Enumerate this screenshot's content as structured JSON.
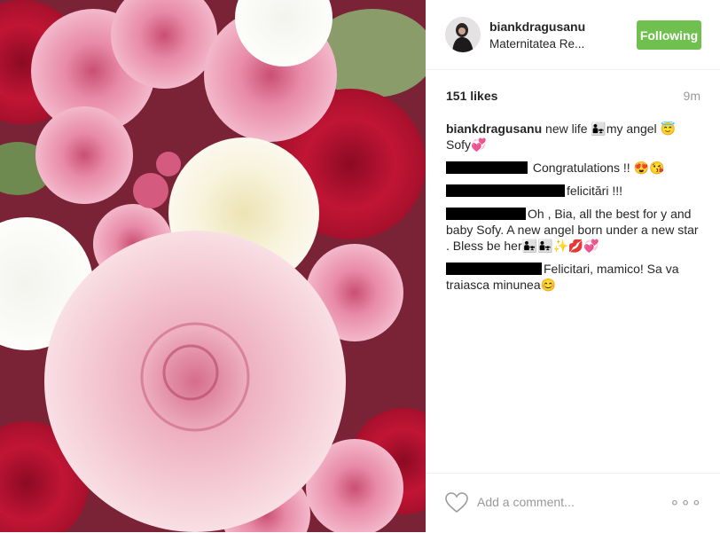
{
  "post": {
    "username": "biankdragusanu",
    "location": "Maternitatea Re...",
    "follow_label": "Following",
    "likes": "151 likes",
    "time": "9m",
    "comment_placeholder": "Add a comment...",
    "more_label": "∘∘∘"
  },
  "comments": [
    {
      "user": "biankdragusanu",
      "text": "new life 👨‍👧my angel 😇",
      "text2": "Sofy💞"
    },
    {
      "user": "",
      "text": "Congratulations !! 😍😘"
    },
    {
      "user": "",
      "text": "felicitări !!!"
    },
    {
      "user": "",
      "text": "Oh , Bia, all the best for y and baby Sofy. A new angel born under a new star . Bless be her👨‍👧👨‍👧✨💋💞"
    },
    {
      "user": "",
      "text": "Felicitari, mamico! Sa va traiasca minunea😊"
    }
  ],
  "colors": {
    "follow_button": "#70c050",
    "text": "#262626",
    "muted": "#999999",
    "redaction": "#000000"
  },
  "icons": {
    "like": "heart-outline-icon",
    "more": "more-options-icon"
  }
}
